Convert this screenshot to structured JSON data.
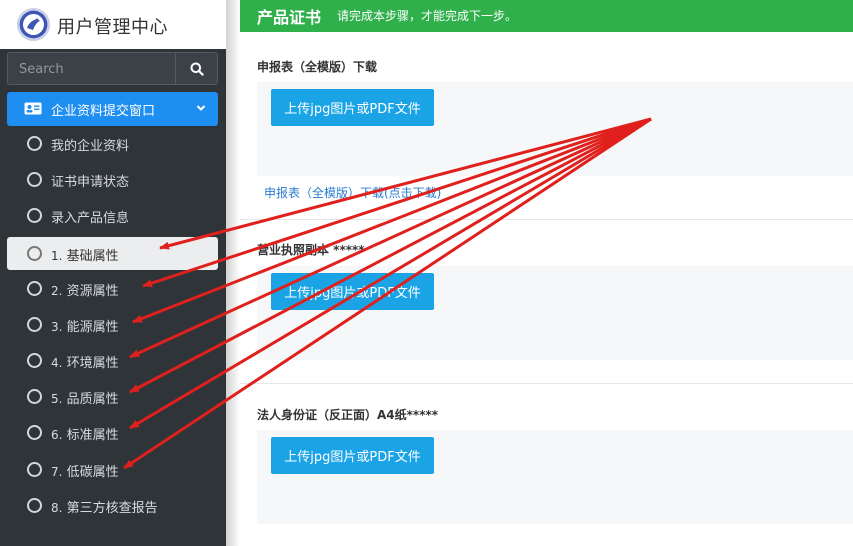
{
  "brand": {
    "title": "用户管理中心",
    "logo_icon": "org-logo-icon"
  },
  "search": {
    "placeholder": "Search",
    "icon": "search-icon"
  },
  "sidebar": {
    "group_label": "企业资料提交窗口",
    "items": [
      {
        "label": "我的企业资料"
      },
      {
        "label": "证书申请状态"
      },
      {
        "label": "录入产品信息"
      },
      {
        "num": "1.",
        "label": "基础属性",
        "active": true
      },
      {
        "num": "2.",
        "label": "资源属性"
      },
      {
        "num": "3.",
        "label": "能源属性"
      },
      {
        "num": "4.",
        "label": "环境属性"
      },
      {
        "num": "5.",
        "label": "品质属性"
      },
      {
        "num": "6.",
        "label": "标准属性"
      },
      {
        "num": "7.",
        "label": "低碳属性"
      },
      {
        "num": "8.",
        "label": "第三方核查报告"
      }
    ]
  },
  "banner": {
    "title": "产品证书",
    "subtitle": "请完成本步骤，才能完成下一步。"
  },
  "sections": [
    {
      "title": "申报表（全模版）下载",
      "button": "上传jpg图片或PDF文件",
      "link": "申报表（全模版）下载(点击下载)"
    },
    {
      "title": "营业执照副本 *****",
      "button": "上传jpg图片或PDF文件"
    },
    {
      "title": "法人身份证（反正面）A4纸*****",
      "button": "上传jpg图片或PDF文件"
    }
  ],
  "colors": {
    "banner": "#2fb04b",
    "primary": "#1f8ef1",
    "upload": "#1aa4e6",
    "arrow": "#e0201c",
    "sidebar": "#2f3438"
  }
}
